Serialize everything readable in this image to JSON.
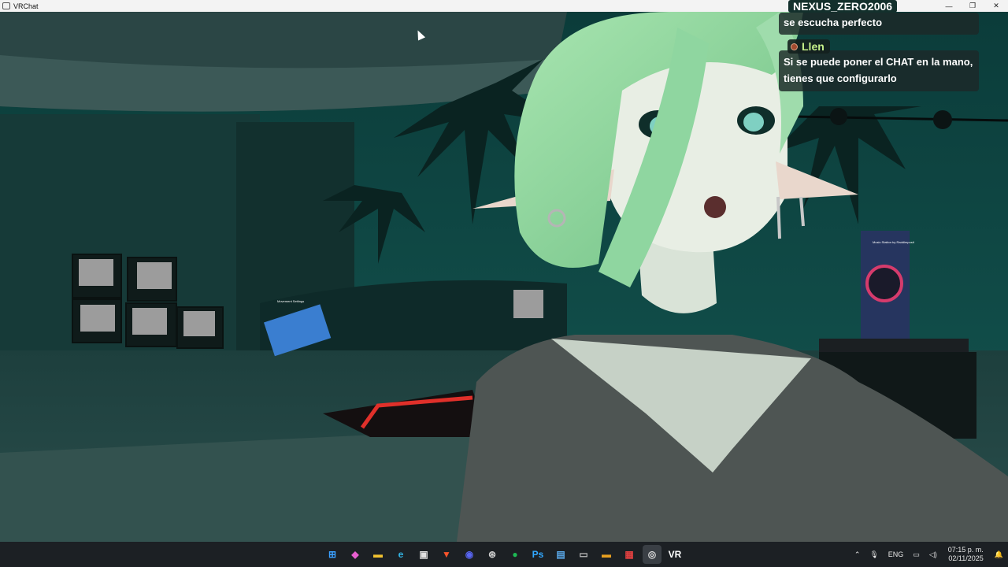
{
  "window": {
    "title": "VRChat"
  },
  "window_controls": {
    "minimize": "—",
    "restore": "❐",
    "close": "✕"
  },
  "chat": {
    "user1": {
      "name": "NEXUS_ZERO2006",
      "message": "se escucha perfecto"
    },
    "user2": {
      "name": "Llen",
      "message_line1": "Si se puede poner el CHAT en la mano,",
      "message_line2": "tienes que configurarlo"
    }
  },
  "scene": {
    "sign_left": "Movement Settings",
    "sign_right": "Music Station by Raddimposit"
  },
  "taskbar": {
    "apps": [
      {
        "name": "windows-start",
        "glyph": "⊞",
        "color": "#3aa0ff"
      },
      {
        "name": "copilot",
        "glyph": "◆",
        "color": "#e85fd0"
      },
      {
        "name": "file-explorer",
        "glyph": "▬",
        "color": "#f2c230"
      },
      {
        "name": "edge",
        "glyph": "e",
        "color": "#33b5e5"
      },
      {
        "name": "store",
        "glyph": "▣",
        "color": "#e0e0e0"
      },
      {
        "name": "brave",
        "glyph": "▼",
        "color": "#fb542b"
      },
      {
        "name": "discord",
        "glyph": "◉",
        "color": "#5865f2"
      },
      {
        "name": "steam-vr",
        "glyph": "⊛",
        "color": "#cfcfcf"
      },
      {
        "name": "spotify",
        "glyph": "●",
        "color": "#1db954"
      },
      {
        "name": "photoshop",
        "glyph": "Ps",
        "color": "#31a8ff"
      },
      {
        "name": "notepad",
        "glyph": "▤",
        "color": "#5aa8e8"
      },
      {
        "name": "terminal",
        "glyph": "▭",
        "color": "#bbbbbb"
      },
      {
        "name": "folder",
        "glyph": "▬",
        "color": "#e8a020"
      },
      {
        "name": "obs-app",
        "glyph": "▦",
        "color": "#e04040"
      },
      {
        "name": "obs",
        "glyph": "◎",
        "color": "#dddddd"
      },
      {
        "name": "vrchat",
        "glyph": "VR",
        "color": "#ffffff"
      }
    ],
    "tray": {
      "chevron": "⌃",
      "mic": "🎙",
      "language": "ENG",
      "time": "07:15 p. m.",
      "date": "02/11/2025"
    }
  }
}
